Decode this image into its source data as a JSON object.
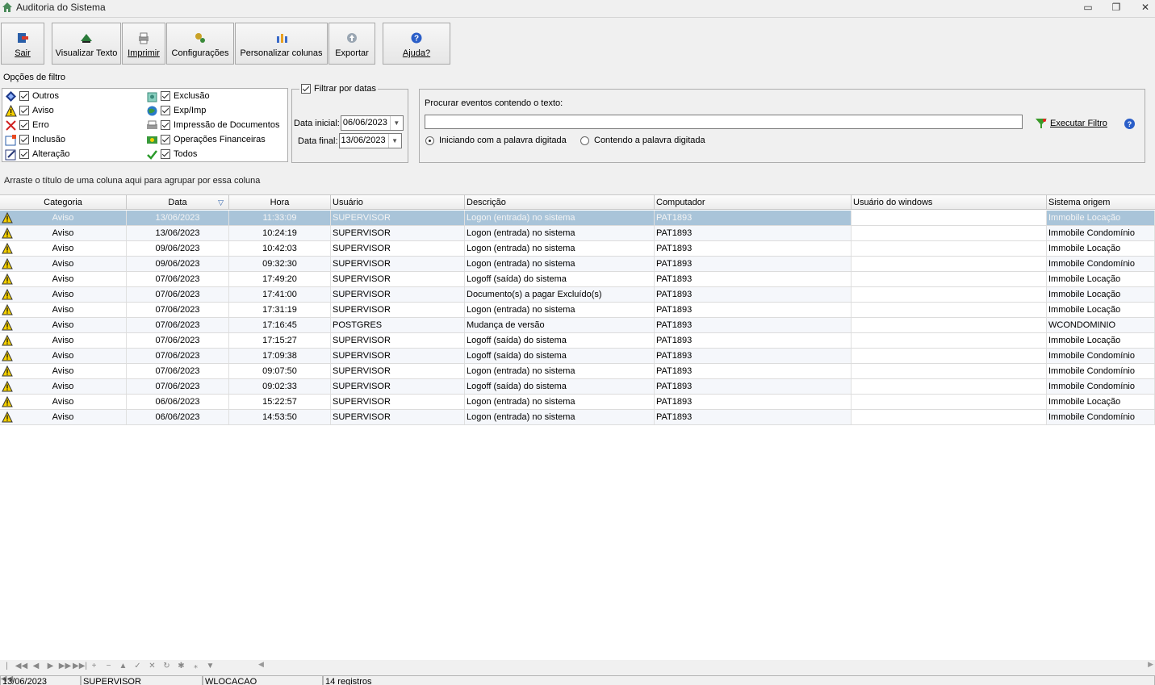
{
  "window": {
    "title": "Auditoria do Sistema",
    "controls": {
      "minimize": "▭",
      "restore": "❐",
      "close": "✕"
    }
  },
  "toolbar": {
    "buttons": [
      {
        "label": "Sair",
        "icon": "exit-icon"
      },
      {
        "label": "Visualizar Texto",
        "icon": "view-text-icon"
      },
      {
        "label": "Imprimir",
        "icon": "printer-icon"
      },
      {
        "label": "Configurações",
        "icon": "settings-icon"
      },
      {
        "label": "Personalizar colunas",
        "icon": "columns-icon"
      },
      {
        "label": "Exportar",
        "icon": "export-icon"
      },
      {
        "label": "Ajuda?",
        "icon": "help-icon"
      }
    ]
  },
  "filters": {
    "title": "Opções de filtro",
    "options": [
      {
        "label": "Outros",
        "checked": true,
        "icon": "diamond-icon"
      },
      {
        "label": "Aviso",
        "checked": true,
        "icon": "warning-icon"
      },
      {
        "label": "Erro",
        "checked": true,
        "icon": "error-x-icon"
      },
      {
        "label": "Inclusão",
        "checked": true,
        "icon": "insert-icon"
      },
      {
        "label": "Alteração",
        "checked": true,
        "icon": "edit-icon"
      },
      {
        "label": "Exclusão",
        "checked": true,
        "icon": "delete-icon"
      },
      {
        "label": "Exp/Imp",
        "checked": true,
        "icon": "globe-icon"
      },
      {
        "label": "Impressão de Documentos",
        "checked": true,
        "icon": "print-docs-icon"
      },
      {
        "label": "Operações Financeiras",
        "checked": true,
        "icon": "money-icon"
      },
      {
        "label": "Todos",
        "checked": true,
        "icon": "check-all-icon"
      }
    ]
  },
  "dates": {
    "legend": "Filtrar por datas",
    "enabled": true,
    "start_label": "Data inicial:",
    "start_value": "06/06/2023",
    "end_label": "Data final:",
    "end_value": "13/06/2023"
  },
  "search": {
    "label": "Procurar eventos contendo o texto:",
    "value": "",
    "execute_label": "Executar Filtro",
    "radio_starting": "Iniciando com a palavra digitada",
    "radio_containing": "Contendo a palavra digitada",
    "selected": "starting"
  },
  "group_hint": "Arraste o título de uma coluna aqui para agrupar por essa coluna",
  "grid": {
    "columns": [
      "Categoria",
      "Data",
      "Hora",
      "Usuário",
      "Descrição",
      "Computador",
      "Usuário do windows",
      "Sistema origem"
    ],
    "sort_indicator": "▽",
    "rows": [
      [
        "Aviso",
        "13/06/2023",
        "11:33:09",
        "SUPERVISOR",
        "Logon (entrada) no sistema",
        "PAT1893",
        "",
        "Immobile Locação"
      ],
      [
        "Aviso",
        "13/06/2023",
        "10:24:19",
        "SUPERVISOR",
        "Logon (entrada) no sistema",
        "PAT1893",
        "",
        "Immobile Condomínio"
      ],
      [
        "Aviso",
        "09/06/2023",
        "10:42:03",
        "SUPERVISOR",
        "Logon (entrada) no sistema",
        "PAT1893",
        "",
        "Immobile Locação"
      ],
      [
        "Aviso",
        "09/06/2023",
        "09:32:30",
        "SUPERVISOR",
        "Logon (entrada) no sistema",
        "PAT1893",
        "",
        "Immobile Condomínio"
      ],
      [
        "Aviso",
        "07/06/2023",
        "17:49:20",
        "SUPERVISOR",
        "Logoff (saída) do sistema",
        "PAT1893",
        "",
        "Immobile Locação"
      ],
      [
        "Aviso",
        "07/06/2023",
        "17:41:00",
        "SUPERVISOR",
        "Documento(s) a pagar Excluído(s)",
        "PAT1893",
        "",
        "Immobile Locação"
      ],
      [
        "Aviso",
        "07/06/2023",
        "17:31:19",
        "SUPERVISOR",
        "Logon (entrada) no sistema",
        "PAT1893",
        "",
        "Immobile Locação"
      ],
      [
        "Aviso",
        "07/06/2023",
        "17:16:45",
        "POSTGRES",
        "Mudança de versão",
        "PAT1893",
        "",
        "WCONDOMINIO"
      ],
      [
        "Aviso",
        "07/06/2023",
        "17:15:27",
        "SUPERVISOR",
        "Logoff (saída) do sistema",
        "PAT1893",
        "",
        "Immobile Locação"
      ],
      [
        "Aviso",
        "07/06/2023",
        "17:09:38",
        "SUPERVISOR",
        "Logoff (saída) do sistema",
        "PAT1893",
        "",
        "Immobile Condomínio"
      ],
      [
        "Aviso",
        "07/06/2023",
        "09:07:50",
        "SUPERVISOR",
        "Logon (entrada) no sistema",
        "PAT1893",
        "",
        "Immobile Condomínio"
      ],
      [
        "Aviso",
        "07/06/2023",
        "09:02:33",
        "SUPERVISOR",
        "Logoff (saída) do sistema",
        "PAT1893",
        "",
        "Immobile Condomínio"
      ],
      [
        "Aviso",
        "06/06/2023",
        "15:22:57",
        "SUPERVISOR",
        "Logon (entrada) no sistema",
        "PAT1893",
        "",
        "Immobile Locação"
      ],
      [
        "Aviso",
        "06/06/2023",
        "14:53:50",
        "SUPERVISOR",
        "Logon (entrada) no sistema",
        "PAT1893",
        "",
        "Immobile Condomínio"
      ]
    ],
    "selected_row": 0
  },
  "navigator": {
    "buttons": [
      "|◀◀",
      "◀◀",
      "◀",
      "▶",
      "▶▶",
      "▶▶|",
      "+",
      "−",
      "▲",
      "✓",
      "✕",
      "↻",
      "✱",
      "⁎",
      "▼"
    ]
  },
  "status": {
    "date": "13/06/2023",
    "user": "SUPERVISOR",
    "system": "WLOCACAO",
    "count": "14 registros"
  },
  "colors": {
    "selected_row": "#a9c4d9",
    "warning_yellow": "#f5d000"
  }
}
